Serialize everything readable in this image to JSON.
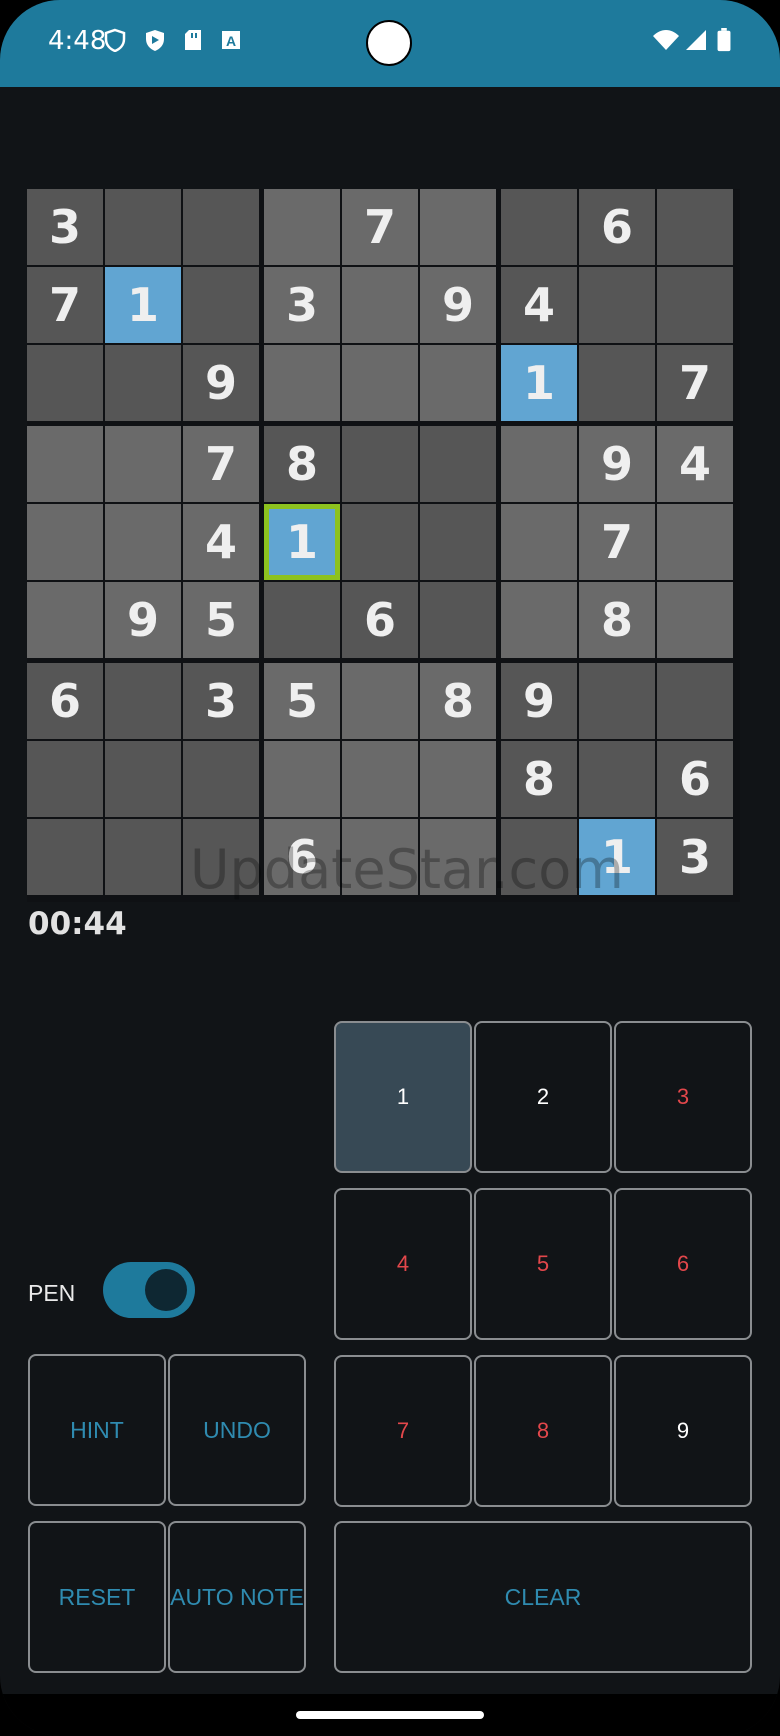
{
  "status_bar": {
    "time": "4:48",
    "left_icons": [
      "shield-icon",
      "play-protect-icon",
      "sd-card-icon",
      "keyboard-a-icon"
    ],
    "right_icons": [
      "wifi-icon",
      "signal-icon",
      "battery-icon"
    ]
  },
  "board": {
    "givens": [
      [
        "3",
        "",
        "",
        "",
        "7",
        "",
        "",
        "6",
        ""
      ],
      [
        "7",
        "1",
        "",
        "3",
        "",
        "9",
        "4",
        "",
        ""
      ],
      [
        "",
        "",
        "9",
        "",
        "",
        "",
        "1",
        "",
        "7"
      ],
      [
        "",
        "",
        "7",
        "8",
        "",
        "",
        "",
        "9",
        "4"
      ],
      [
        "",
        "",
        "4",
        "1",
        "",
        "",
        "",
        "7",
        ""
      ],
      [
        "",
        "9",
        "5",
        "",
        "6",
        "",
        "",
        "8",
        ""
      ],
      [
        "6",
        "",
        "3",
        "5",
        "",
        "8",
        "9",
        "",
        ""
      ],
      [
        "",
        "",
        "",
        "",
        "",
        "",
        "8",
        "",
        "6"
      ],
      [
        "",
        "",
        "",
        "6",
        "",
        "",
        "",
        "1",
        "3"
      ]
    ],
    "selected_cell": [
      4,
      3
    ],
    "highlighted_value": "1",
    "colors": {
      "cell_dark": "#565656",
      "cell_light": "#6a6a6a",
      "highlight": "#61a5d2",
      "selected_border": "#8dc21f",
      "digit": "#efefef"
    }
  },
  "timer": "00:44",
  "watermark": "UpdateStar.com",
  "controls": {
    "pen_label": "PEN",
    "pen_on": true,
    "hint": "HINT",
    "undo": "UNDO",
    "reset": "RESET",
    "auto_note": "AUTO NOTE",
    "clear": "CLEAR",
    "accent": "#2f8bb0"
  },
  "number_pad": [
    {
      "label": "1",
      "color": "#ffffff",
      "selected": true
    },
    {
      "label": "2",
      "color": "#ffffff",
      "selected": false
    },
    {
      "label": "3",
      "color": "#e2474b",
      "selected": false
    },
    {
      "label": "4",
      "color": "#e2474b",
      "selected": false
    },
    {
      "label": "5",
      "color": "#e2474b",
      "selected": false
    },
    {
      "label": "6",
      "color": "#e2474b",
      "selected": false
    },
    {
      "label": "7",
      "color": "#e2474b",
      "selected": false
    },
    {
      "label": "8",
      "color": "#e2474b",
      "selected": false
    },
    {
      "label": "9",
      "color": "#ffffff",
      "selected": false
    }
  ]
}
